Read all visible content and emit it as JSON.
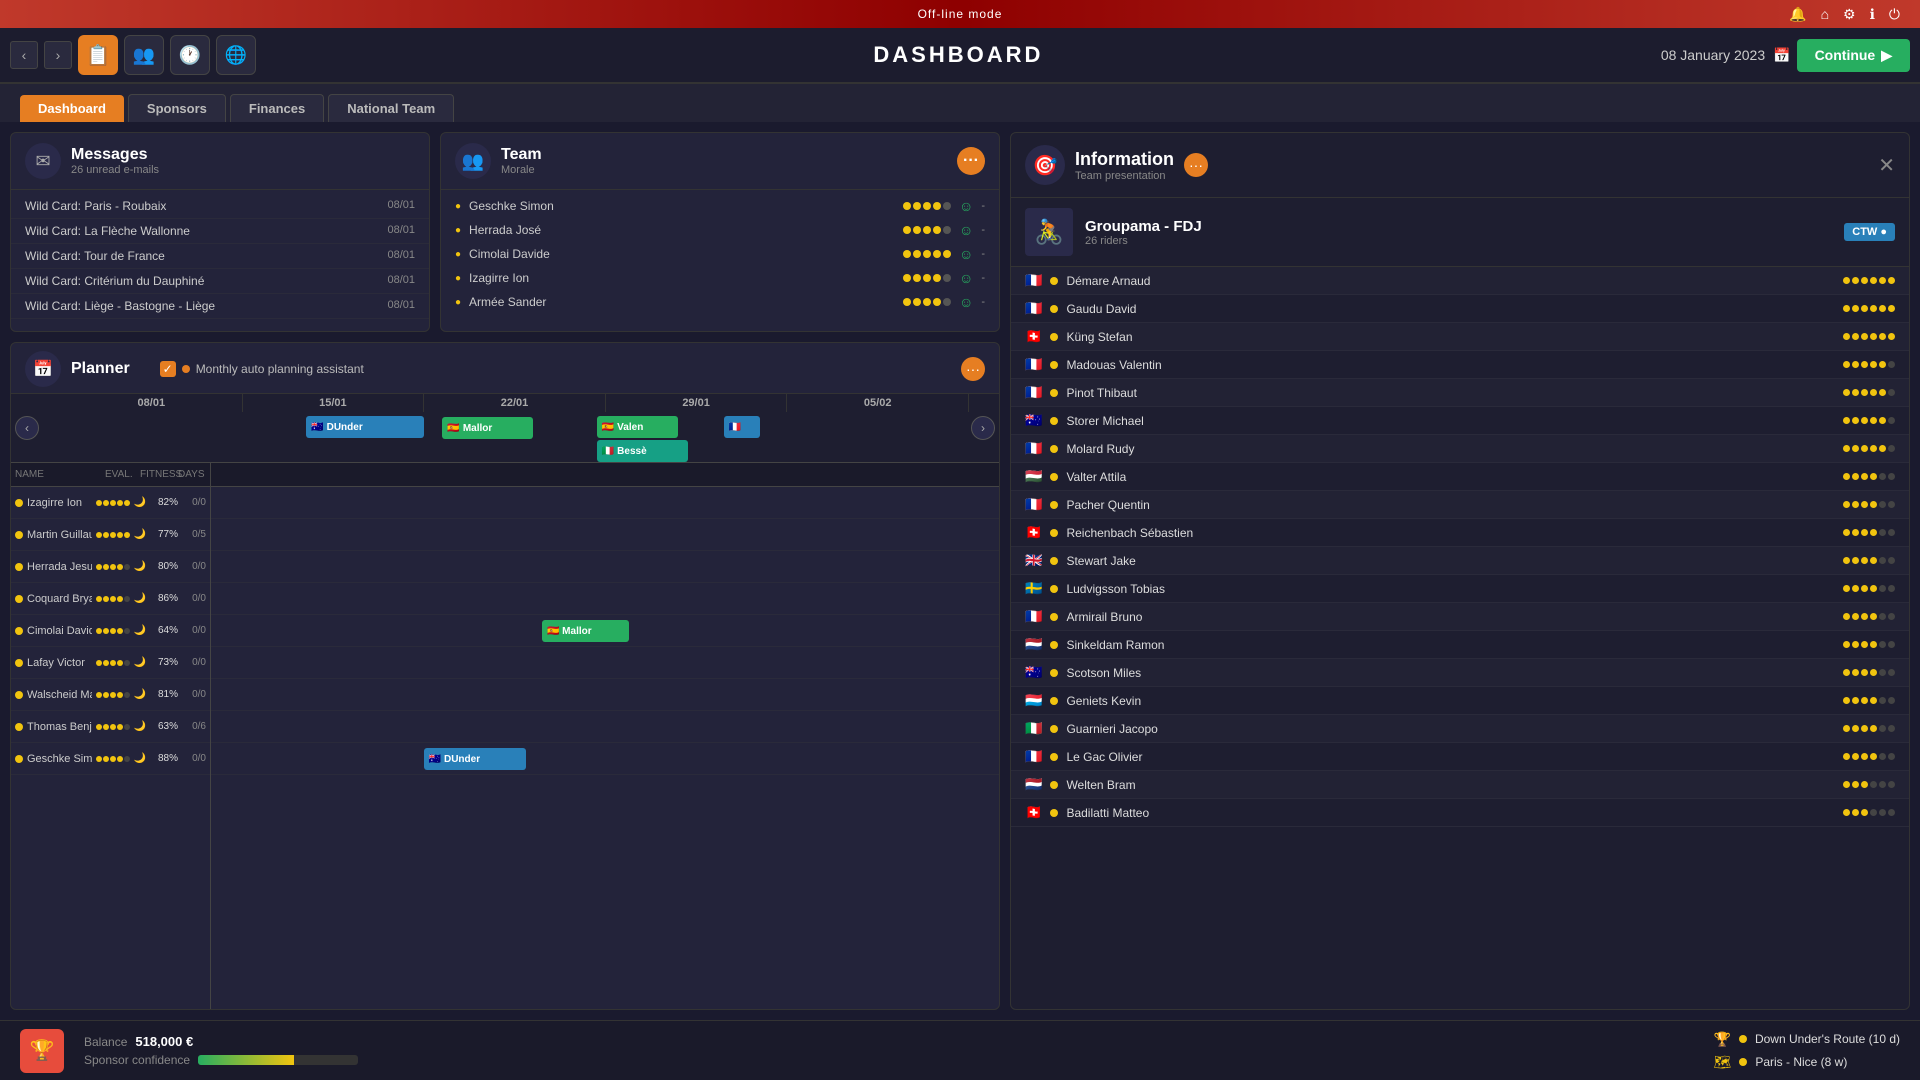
{
  "app": {
    "mode": "Off-line mode",
    "title": "DASHBOARD",
    "date": "08 January 2023",
    "continue_label": "Continue"
  },
  "tabs": [
    {
      "label": "Dashboard",
      "active": true
    },
    {
      "label": "Sponsors",
      "active": false
    },
    {
      "label": "Finances",
      "active": false
    },
    {
      "label": "National Team",
      "active": false
    }
  ],
  "messages": {
    "title": "Messages",
    "subtitle": "26 unread e-mails",
    "items": [
      {
        "subject": "Wild Card: Paris - Roubaix",
        "date": "08/01"
      },
      {
        "subject": "Wild Card: La Flèche Wallonne",
        "date": "08/01"
      },
      {
        "subject": "Wild Card: Tour de France",
        "date": "08/01"
      },
      {
        "subject": "Wild Card: Critérium du Dauphiné",
        "date": "08/01"
      },
      {
        "subject": "Wild Card: Liège - Bastogne - Liège",
        "date": "08/01"
      }
    ]
  },
  "team": {
    "title": "Team",
    "subtitle": "Morale",
    "riders": [
      {
        "name": "Geschke Simon",
        "morale": 4,
        "max": 5,
        "score": "-"
      },
      {
        "name": "Herrada José",
        "morale": 4,
        "max": 5,
        "score": "-"
      },
      {
        "name": "Cimolai Davide",
        "morale": 5,
        "max": 5,
        "score": "-"
      },
      {
        "name": "Izagirre Ion",
        "morale": 4,
        "max": 5,
        "score": "-"
      },
      {
        "name": "Armée Sander",
        "morale": 4,
        "max": 5,
        "score": "-"
      }
    ]
  },
  "planner": {
    "title": "Planner",
    "auto_label": "Monthly auto planning assistant",
    "dates": [
      "08/01",
      "15/01",
      "22/01",
      "29/01",
      "05/02"
    ],
    "cols": [
      "NAME",
      "EVAL.",
      "FITNESS",
      "DAYS"
    ],
    "riders": [
      {
        "name": "Izagirre Ion",
        "eval": 5,
        "moon": true,
        "fitness": "82%",
        "days": "0/0"
      },
      {
        "name": "Martin Guillaume",
        "eval": 5,
        "moon": true,
        "fitness": "77%",
        "days": "0/5"
      },
      {
        "name": "Herrada Jesus",
        "eval": 4,
        "moon": true,
        "fitness": "80%",
        "days": "0/0"
      },
      {
        "name": "Coquard Bryan",
        "eval": 4,
        "moon": true,
        "fitness": "86%",
        "days": "0/0"
      },
      {
        "name": "Cimolai Davide",
        "eval": 4,
        "moon": true,
        "fitness": "64%",
        "days": "0/0"
      },
      {
        "name": "Lafay Victor",
        "eval": 4,
        "moon": true,
        "fitness": "73%",
        "days": "0/0"
      },
      {
        "name": "Walscheid Max",
        "eval": 4,
        "moon": true,
        "fitness": "81%",
        "days": "0/0"
      },
      {
        "name": "Thomas Benjamin",
        "eval": 4,
        "moon": true,
        "fitness": "63%",
        "days": "0/6"
      },
      {
        "name": "Geschke Simon",
        "eval": 4,
        "moon": true,
        "fitness": "88%",
        "days": "0/0"
      }
    ],
    "calendar_events": [
      {
        "row": 0,
        "label": "DUnder",
        "left_pct": 30,
        "width_pct": 12,
        "color": "blue",
        "flag": "au"
      },
      {
        "row": 0,
        "label": "Mallor",
        "left_pct": 44,
        "width_pct": 10,
        "color": "green",
        "flag": "es"
      },
      {
        "row": 0,
        "label": "Valen",
        "left_pct": 62,
        "width_pct": 9,
        "color": "green",
        "flag": "es"
      },
      {
        "row": 0,
        "label": "Bessè",
        "left_pct": 62,
        "width_pct": 9,
        "color": "teal",
        "flag": "it"
      },
      {
        "row": 0,
        "label": "fr",
        "left_pct": 74,
        "width_pct": 3,
        "color": "blue",
        "flag": "fr"
      },
      {
        "row": 4,
        "label": "Mallor",
        "left_pct": 44,
        "width_pct": 10,
        "color": "green",
        "flag": "es"
      },
      {
        "row": 8,
        "label": "DUnder",
        "left_pct": 30,
        "width_pct": 12,
        "color": "blue",
        "flag": "au"
      }
    ]
  },
  "information": {
    "title": "Information",
    "subtitle": "Team presentation",
    "team_name": "Groupama - FDJ",
    "riders_count": "26 riders",
    "ctw_label": "CTW",
    "riders": [
      {
        "name": "Démare Arnaud",
        "flag": "🇫🇷",
        "rating": 6,
        "max": 6
      },
      {
        "name": "Gaudu David",
        "flag": "🇫🇷",
        "rating": 6,
        "max": 6
      },
      {
        "name": "Küng Stefan",
        "flag": "🇨🇭",
        "rating": 6,
        "max": 6
      },
      {
        "name": "Madouas Valentin",
        "flag": "🇫🇷",
        "rating": 5,
        "max": 6
      },
      {
        "name": "Pinot Thibaut",
        "flag": "🇫🇷",
        "rating": 5,
        "max": 6
      },
      {
        "name": "Storer Michael",
        "flag": "🇦🇺",
        "rating": 5,
        "max": 6
      },
      {
        "name": "Molard Rudy",
        "flag": "🇫🇷",
        "rating": 5,
        "max": 6
      },
      {
        "name": "Valter Attila",
        "flag": "🇭🇺",
        "rating": 4,
        "max": 6
      },
      {
        "name": "Pacher Quentin",
        "flag": "🇫🇷",
        "rating": 4,
        "max": 6
      },
      {
        "name": "Reichenbach Sébastien",
        "flag": "🇨🇭",
        "rating": 4,
        "max": 6
      },
      {
        "name": "Stewart Jake",
        "flag": "🇬🇧",
        "rating": 4,
        "max": 6
      },
      {
        "name": "Ludvigsson Tobias",
        "flag": "🇸🇪",
        "rating": 4,
        "max": 6
      },
      {
        "name": "Armirail Bruno",
        "flag": "🇫🇷",
        "rating": 4,
        "max": 6
      },
      {
        "name": "Sinkeldam Ramon",
        "flag": "🇳🇱",
        "rating": 4,
        "max": 6
      },
      {
        "name": "Scotson Miles",
        "flag": "🇦🇺",
        "rating": 4,
        "max": 6
      },
      {
        "name": "Geniets Kevin",
        "flag": "🇱🇺",
        "rating": 4,
        "max": 6
      },
      {
        "name": "Guarnieri Jacopo",
        "flag": "🇮🇹",
        "rating": 4,
        "max": 6
      },
      {
        "name": "Le Gac Olivier",
        "flag": "🇫🇷",
        "rating": 4,
        "max": 6
      },
      {
        "name": "Welten Bram",
        "flag": "🇳🇱",
        "rating": 3,
        "max": 6
      },
      {
        "name": "Badilatti Matteo",
        "flag": "🇨🇭",
        "rating": 3,
        "max": 6
      }
    ]
  },
  "bottom_bar": {
    "balance_label": "Balance",
    "balance_value": "518,000 €",
    "sponsor_label": "Sponsor confidence",
    "events": [
      {
        "icon": "trophy",
        "label": "Down Under's Route (10 d)"
      },
      {
        "icon": "route",
        "label": "Paris - Nice (8 w)"
      }
    ]
  }
}
